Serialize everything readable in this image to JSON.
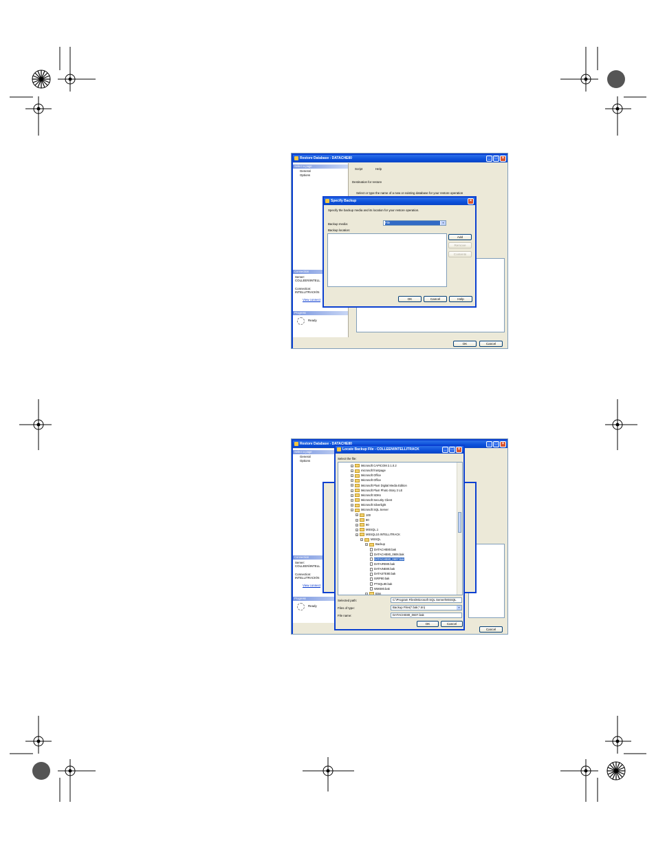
{
  "shot1": {
    "main_window": {
      "title": "Restore Database - DATACHE80",
      "toolbar": {
        "script_label": "Script",
        "help_label": "Help"
      },
      "select_page": {
        "header": "Select a page",
        "items": [
          "General",
          "Options"
        ]
      },
      "connection": {
        "header": "Connection",
        "server_label": "Server:",
        "server_value": "COLLEEN\\INTELL",
        "connection_label": "Connection:",
        "connection_value": "INTELLITRACK\\N",
        "link": "View connect"
      },
      "progress": {
        "header": "Progress",
        "status": "Ready"
      },
      "destination_label": "Destination for restore",
      "select_prompt": "Select or type the name of a new or existing database for your restore operation",
      "ok_label": "OK",
      "cancel_label": "Cancel"
    },
    "specify_backup": {
      "title": "Specify Backup",
      "description": "Specify the backup media and its location for your restore operation.",
      "media_label": "Backup media:",
      "media_value": "File",
      "location_label": "Backup location:",
      "add_label": "Add",
      "remove_label": "Remove",
      "contents_label": "Contents",
      "ok_label": "OK",
      "cancel_label": "Cancel",
      "help_label": "Help"
    }
  },
  "shot2": {
    "main_window": {
      "title": "Restore Database - DATACHE80",
      "select_page": {
        "header": "Select a page",
        "items": [
          "General",
          "Options"
        ]
      },
      "connection": {
        "header": "Connection",
        "server_label": "Server:",
        "server_value": "COLLEEN\\INTELL",
        "connection_label": "Connection:",
        "connection_value": "INTELLITRACK\\N",
        "link": "View connect"
      },
      "progress": {
        "header": "Progress",
        "status": "Ready"
      },
      "cancel_label": "Cancel"
    },
    "locate_backup": {
      "title": "Locate Backup File - COLLEEN\\INTELLITRACK",
      "select_label": "Select the file:",
      "tree": [
        {
          "label": "Microsoft CAPICOM 2.1.0.2",
          "type": "folder",
          "level": 0
        },
        {
          "label": "microsoft frontpage",
          "type": "folder",
          "level": 0
        },
        {
          "label": "Microsoft Office",
          "type": "folder",
          "level": 0
        },
        {
          "label": "Microsoft Office",
          "type": "folder",
          "level": 0
        },
        {
          "label": "Microsoft Plus! Digital Media Edition",
          "type": "folder",
          "level": 0
        },
        {
          "label": "Microsoft Plus! Photo Story 2 LE",
          "type": "folder",
          "level": 0
        },
        {
          "label": "Microsoft SDKs",
          "type": "folder",
          "level": 0
        },
        {
          "label": "Microsoft Security Client",
          "type": "folder",
          "level": 0
        },
        {
          "label": "Microsoft Silverlight",
          "type": "folder",
          "level": 0
        },
        {
          "label": "Microsoft SQL Server",
          "type": "folder",
          "level": 0
        },
        {
          "label": "100",
          "type": "folder",
          "level": 1
        },
        {
          "label": "80",
          "type": "folder",
          "level": 1
        },
        {
          "label": "90",
          "type": "folder",
          "level": 1
        },
        {
          "label": "MSSQL.1",
          "type": "folder",
          "level": 1
        },
        {
          "label": "MSSQL10.INTELLITRACK",
          "type": "folder",
          "level": 1
        },
        {
          "label": "MSSQL",
          "type": "folder",
          "level": 2
        },
        {
          "label": "Backup",
          "type": "folder",
          "level": 3
        },
        {
          "label": "DATACHE80.bak",
          "type": "file",
          "level": 4
        },
        {
          "label": "DATACHE80_0606.bak",
          "type": "file",
          "level": 4
        },
        {
          "label": "DATACHE80_0607.bak",
          "type": "file",
          "level": 4,
          "selected": true
        },
        {
          "label": "DATAIRE80.bak",
          "type": "file",
          "level": 4
        },
        {
          "label": "DATAINE80.bak",
          "type": "file",
          "level": 4
        },
        {
          "label": "DATASTE80.bak",
          "type": "file",
          "level": 4
        },
        {
          "label": "ISRP80.bak",
          "type": "file",
          "level": 4
        },
        {
          "label": "PTSQL80.bak",
          "type": "file",
          "level": 4
        },
        {
          "label": "WMS80.bak",
          "type": "file",
          "level": 4
        },
        {
          "label": "Binn",
          "type": "folder",
          "level": 3
        }
      ],
      "selected_path_label": "Selected path:",
      "selected_path_value": "C:\\Program Files\\Microsoft SQL Server\\MSSQL",
      "files_of_type_label": "Files of type:",
      "files_of_type_value": "Backup Files(*.bak;*.tm)",
      "file_name_label": "File name:",
      "file_name_value": "DATACHE80_0607.bak",
      "ok_label": "OK",
      "cancel_label": "Cancel"
    }
  }
}
